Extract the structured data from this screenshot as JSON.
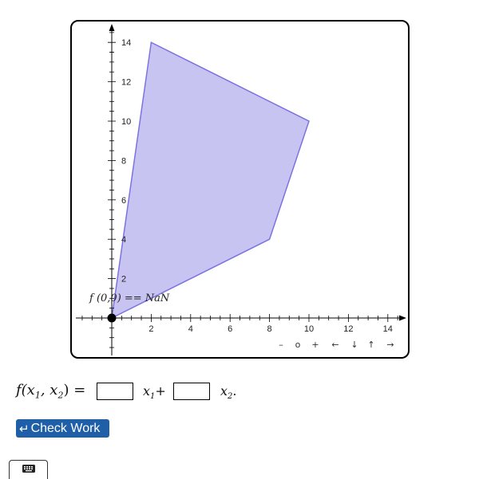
{
  "graph": {
    "x_ticks": [
      2,
      4,
      6,
      8,
      10,
      12,
      14
    ],
    "y_ticks": [
      2,
      4,
      6,
      8,
      10,
      12,
      14
    ],
    "polygon": [
      [
        0,
        0
      ],
      [
        2,
        14
      ],
      [
        10,
        10
      ],
      [
        8,
        4
      ]
    ],
    "point": [
      0,
      0
    ],
    "point_label": "f (0,0) == NaN",
    "fill_color": "#c8c4f2",
    "stroke_color": "#7b73e0",
    "nav_buttons": [
      "–",
      "o",
      "+",
      "←",
      "↓",
      "↑",
      "→"
    ]
  },
  "formula": {
    "lhs": "f(x",
    "lhs_sub1": "1",
    "lhs_mid": ", x",
    "lhs_sub2": "2",
    "lhs_end": ") =",
    "term1": "x",
    "term1_sub": "1",
    "plus": "+",
    "term2": "x",
    "term2_sub": "2",
    "period": ".",
    "coef1_value": "",
    "coef2_value": ""
  },
  "check_work": {
    "icon": "return-arrow-icon",
    "label": "Check Work"
  },
  "keyboard_toggle": {
    "icon": "keyboard-icon"
  }
}
